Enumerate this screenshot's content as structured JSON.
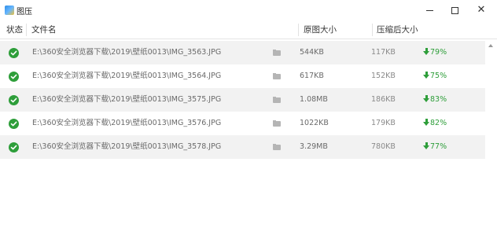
{
  "window": {
    "title": "图压"
  },
  "header": {
    "status": "状态",
    "filename": "文件名",
    "original_size": "原图大小",
    "compressed_size": "压缩后大小"
  },
  "rows": [
    {
      "path": "E:\\360安全浏览器下载\\2019\\壁纸0013\\IMG_3563.JPG",
      "original": "544KB",
      "compressed": "117KB",
      "ratio": "79%"
    },
    {
      "path": "E:\\360安全浏览器下载\\2019\\壁纸0013\\IMG_3564.JPG",
      "original": "617KB",
      "compressed": "152KB",
      "ratio": "75%"
    },
    {
      "path": "E:\\360安全浏览器下载\\2019\\壁纸0013\\IMG_3575.JPG",
      "original": "1.08MB",
      "compressed": "186KB",
      "ratio": "83%"
    },
    {
      "path": "E:\\360安全浏览器下载\\2019\\壁纸0013\\IMG_3576.JPG",
      "original": "1022KB",
      "compressed": "179KB",
      "ratio": "82%"
    },
    {
      "path": "E:\\360安全浏览器下载\\2019\\壁纸0013\\IMG_3578.JPG",
      "original": "3.29MB",
      "compressed": "780KB",
      "ratio": "77%"
    }
  ],
  "icons": {
    "status": "check-circle-icon",
    "folder": "folder-icon",
    "ratio": "arrow-down-icon",
    "minimize": "minimize-icon",
    "maximize": "maximize-icon",
    "close": "close-icon"
  },
  "colors": {
    "success": "#2e9e3a",
    "row_alt": "#f2f2f2"
  }
}
